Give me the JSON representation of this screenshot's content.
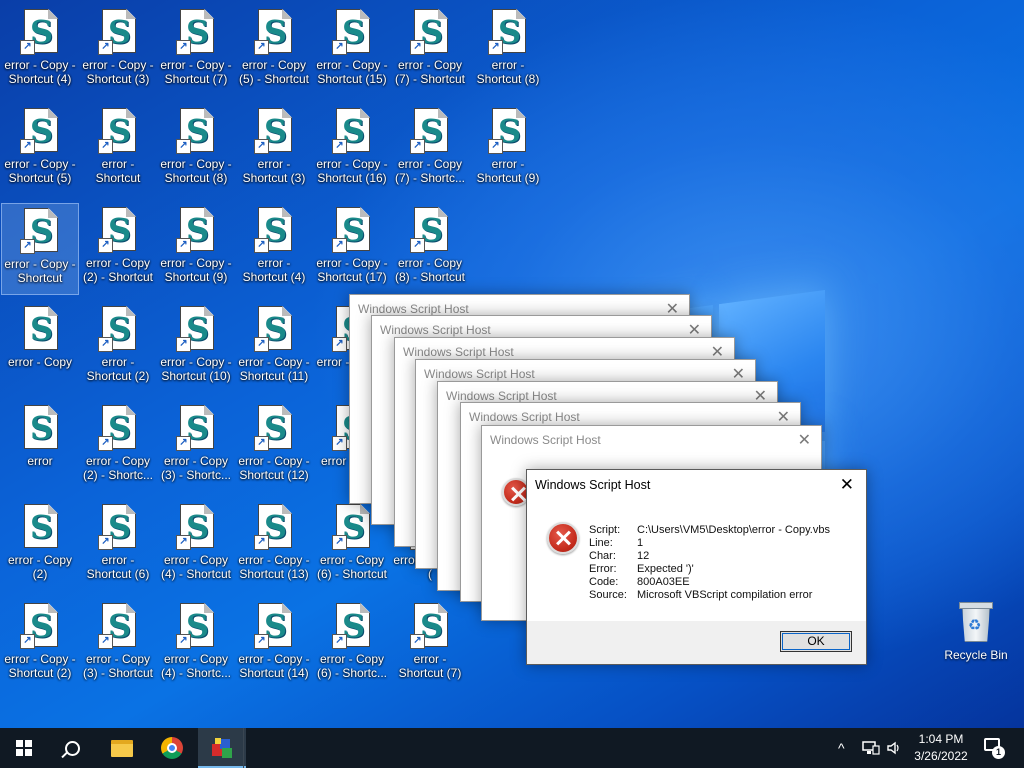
{
  "desktop": {
    "icons": [
      {
        "label": "error - Copy - Shortcut (4)",
        "shortcut": true
      },
      {
        "label": "error - Copy - Shortcut (3)",
        "shortcut": true
      },
      {
        "label": "error - Copy - Shortcut (7)",
        "shortcut": true
      },
      {
        "label": "error - Copy (5) - Shortcut",
        "shortcut": true
      },
      {
        "label": "error - Copy - Shortcut (15)",
        "shortcut": true
      },
      {
        "label": "error - Copy (7) - Shortcut",
        "shortcut": true
      },
      {
        "label": "error - Shortcut (8)",
        "shortcut": true
      },
      {
        "label": "error - Copy - Shortcut (5)",
        "shortcut": true
      },
      {
        "label": "error - Shortcut",
        "shortcut": true
      },
      {
        "label": "error - Copy - Shortcut (8)",
        "shortcut": true
      },
      {
        "label": "error - Shortcut (3)",
        "shortcut": true
      },
      {
        "label": "error - Copy - Shortcut (16)",
        "shortcut": true
      },
      {
        "label": "error - Copy (7) - Shortc...",
        "shortcut": true
      },
      {
        "label": "error - Shortcut (9)",
        "shortcut": true
      },
      {
        "label": "error - Copy - Shortcut",
        "shortcut": true,
        "selected": true
      },
      {
        "label": "error - Copy (2) - Shortcut",
        "shortcut": true
      },
      {
        "label": "error - Copy - Shortcut (9)",
        "shortcut": true
      },
      {
        "label": "error - Shortcut (4)",
        "shortcut": true
      },
      {
        "label": "error - Copy - Shortcut (17)",
        "shortcut": true
      },
      {
        "label": "error - Copy (8) - Shortcut",
        "shortcut": true
      },
      {
        "label": "error - Copy",
        "shortcut": false
      },
      {
        "label": "error - Shortcut (2)",
        "shortcut": true
      },
      {
        "label": "error - Copy - Shortcut (10)",
        "shortcut": true
      },
      {
        "label": "error - Copy - Shortcut (11)",
        "shortcut": true
      },
      {
        "label": "error - Shortc",
        "shortcut": true
      },
      {
        "label": "error",
        "shortcut": false
      },
      {
        "label": "error - Copy (2) - Shortc...",
        "shortcut": true
      },
      {
        "label": "error - Copy (3) - Shortc...",
        "shortcut": true
      },
      {
        "label": "error - Copy - Shortcut (12)",
        "shortcut": true
      },
      {
        "label": "error (5) - S",
        "shortcut": true
      },
      {
        "label": "error - Copy (2)",
        "shortcut": false
      },
      {
        "label": "error - Shortcut (6)",
        "shortcut": true
      },
      {
        "label": "error - Copy (4) - Shortcut",
        "shortcut": true
      },
      {
        "label": "error - Copy - Shortcut (13)",
        "shortcut": true
      },
      {
        "label": "error - Copy (6) - Shortcut",
        "shortcut": true
      },
      {
        "label": "error Shortcut (",
        "shortcut": true
      },
      {
        "label": "error - Copy - Shortcut (2)",
        "shortcut": true
      },
      {
        "label": "error - Copy (3) - Shortcut",
        "shortcut": true
      },
      {
        "label": "error - Copy (4) - Shortc...",
        "shortcut": true
      },
      {
        "label": "error - Copy - Shortcut (14)",
        "shortcut": true
      },
      {
        "label": "error - Copy (6) - Shortc...",
        "shortcut": true
      },
      {
        "label": "error - Shortcut (7)",
        "shortcut": true
      }
    ],
    "recycle_bin_label": "Recycle Bin"
  },
  "stacked_dialogs": {
    "title": "Windows Script Host",
    "close_glyph": "✕",
    "count": 7
  },
  "dialog": {
    "title": "Windows Script Host",
    "close_glyph": "✕",
    "fields": [
      {
        "key": "Script:",
        "value": "C:\\Users\\VM5\\Desktop\\error - Copy.vbs"
      },
      {
        "key": "Line:",
        "value": "1"
      },
      {
        "key": "Char:",
        "value": "12"
      },
      {
        "key": "Error:",
        "value": "Expected ')'"
      },
      {
        "key": "Code:",
        "value": "800A03EE"
      },
      {
        "key": "Source:",
        "value": "Microsoft VBScript compilation error"
      }
    ],
    "ok_label": "OK"
  },
  "taskbar": {
    "apps": [
      "start",
      "search",
      "file-explorer",
      "chrome",
      "windows-script-host"
    ],
    "time": "1:04 PM",
    "date": "3/26/2022",
    "notification_count": "1",
    "tray_chevron": "^"
  },
  "colors": {
    "error_red": "#c42b1c",
    "taskbar": "#101923",
    "accent": "#0a64c8"
  }
}
